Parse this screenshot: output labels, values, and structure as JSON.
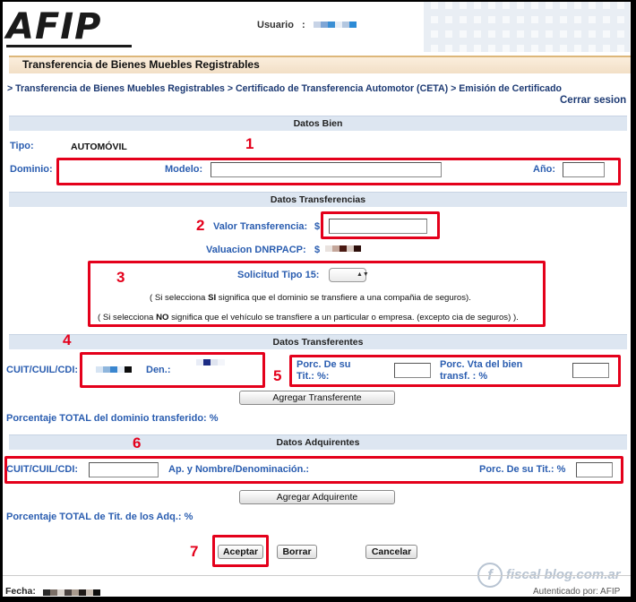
{
  "header": {
    "logo_text": "AFIP",
    "usuario_label": "Usuario",
    "usuario_sep": ":",
    "usuario_pixel_colors": [
      "#c7d3e6",
      "#7fa6d6",
      "#3b8fd4",
      "#e8eef6",
      "#b3c7e0",
      "#2d8bd6"
    ]
  },
  "title": "Transferencia de Bienes Muebles Registrables",
  "breadcrumb": "> Transferencia de Bienes Muebles Registrables > Certificado de Transferencia Automotor (CETA) > Emisión de Certificado",
  "cerrar_sesion": "Cerrar sesion",
  "datos_bien": {
    "band": "Datos Bien",
    "tipo_label": "Tipo:",
    "tipo_value": "AUTOMÓVIL",
    "dominio_label": "Dominio:",
    "modelo_label": "Modelo:",
    "anio_label": "Año:"
  },
  "datos_transferencias": {
    "band": "Datos Transferencias",
    "valor_label": "Valor Transferencia:",
    "valor_currency": "$",
    "valuacion_label": "Valuacion DNRPACP:",
    "valuacion_currency": "$",
    "valuacion_pixel_colors": [
      "#e9e2de",
      "#c4a69a",
      "#4a1a12",
      "#d8c8c0",
      "#2b0e0a"
    ],
    "solicitud_label": "Solicitud Tipo 15:",
    "select_arrow": "▲▼",
    "note_si_pre": "( Si selecciona ",
    "note_si_bold": "SI",
    "note_si_post": " significa que el dominio se transfiere a una compañia de seguros).",
    "note_no_pre": "( Si selecciona ",
    "note_no_bold": "NO",
    "note_no_post": " significa que el vehículo se transfiere a un particular o empresa. (excepto cia de seguros) )."
  },
  "datos_transferentes": {
    "band": "Datos Transferentes",
    "cuit_label": "CUIT/CUIL/CDI:",
    "cuit_pixel_colors": [
      "#d6e4f3",
      "#8fb6dd",
      "#3a86cf",
      "#e9eff7",
      "#0c0c0c"
    ],
    "den_label": "Den.:",
    "den_pixel_colors": [
      "#e8ecf6",
      "#1c2b84",
      "#dfe4f0",
      "#f3f5fa"
    ],
    "porc_label_1": "Porc. De su",
    "porc_label_2": "Tit.: %:",
    "porc_vta_label_1": "Porc. Vta del bien",
    "porc_vta_label_2": "transf. : %",
    "agregar_button": "Agregar Transferente",
    "total_text": "Porcentaje TOTAL del dominio transferido: %"
  },
  "datos_adquirentes": {
    "band": "Datos Adquirentes",
    "cuit_label": "CUIT/CUIL/CDI:",
    "nombre_label": "Ap. y Nombre/Denominación.:",
    "porc_label": "Porc. De su Tit.: %",
    "agregar_button": "Agregar Adquirente",
    "total_text": "Porcentaje TOTAL de Tit. de los Adq.: %"
  },
  "actions": {
    "aceptar": "Aceptar",
    "borrar": "Borrar",
    "cancelar": "Cancelar"
  },
  "annotations": {
    "n1": "1",
    "n2": "2",
    "n3": "3",
    "n4": "4",
    "n5": "5",
    "n6": "6",
    "n7": "7",
    "color": "#e4001b"
  },
  "footer": {
    "fecha_label": "Fecha:",
    "fecha_pixel_colors": [
      "#2a2a2a",
      "#7a6e66",
      "#d9d2cc",
      "#4a4240",
      "#a89a8e",
      "#1f1a18",
      "#c9bdb2",
      "#0e0e0e"
    ],
    "autenticado": "Autenticado por: AFIP",
    "watermark": "fiscal blog.com.ar",
    "watermark_icon": "f"
  }
}
